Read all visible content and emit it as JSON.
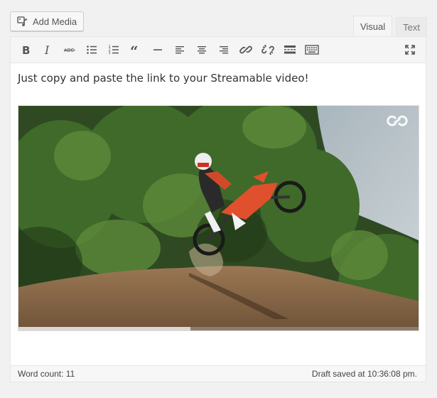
{
  "toolbar_top": {
    "add_media_label": "Add Media"
  },
  "tabs": [
    {
      "label": "Visual",
      "active": true
    },
    {
      "label": "Text",
      "active": false
    }
  ],
  "editor": {
    "toolbar_buttons": [
      {
        "name": "bold",
        "icon": "bold-icon"
      },
      {
        "name": "italic",
        "icon": "italic-icon"
      },
      {
        "name": "strikethrough",
        "icon": "strikethrough-icon"
      },
      {
        "name": "bulleted-list",
        "icon": "bulleted-list-icon"
      },
      {
        "name": "numbered-list",
        "icon": "numbered-list-icon"
      },
      {
        "name": "blockquote",
        "icon": "blockquote-icon"
      },
      {
        "name": "horizontal-line",
        "icon": "horizontal-line-icon"
      },
      {
        "name": "align-left",
        "icon": "align-left-icon"
      },
      {
        "name": "align-center",
        "icon": "align-center-icon"
      },
      {
        "name": "align-right",
        "icon": "align-right-icon"
      },
      {
        "name": "insert-link",
        "icon": "link-icon"
      },
      {
        "name": "remove-link",
        "icon": "unlink-icon"
      },
      {
        "name": "read-more",
        "icon": "read-more-icon"
      },
      {
        "name": "toolbar-toggle",
        "icon": "keyboard-icon"
      },
      {
        "name": "fullscreen",
        "icon": "fullscreen-icon"
      }
    ],
    "body_text": "Just copy and paste the link to your Streamable video!",
    "video": {
      "progress_fraction": 0.43
    }
  },
  "status": {
    "word_count": "Word count: 11",
    "draft_saved": "Draft saved at 10:36:08 pm."
  },
  "colors": {
    "background": "#f1f1f1",
    "toolbar": "#f5f5f5",
    "icon": "#555555"
  }
}
